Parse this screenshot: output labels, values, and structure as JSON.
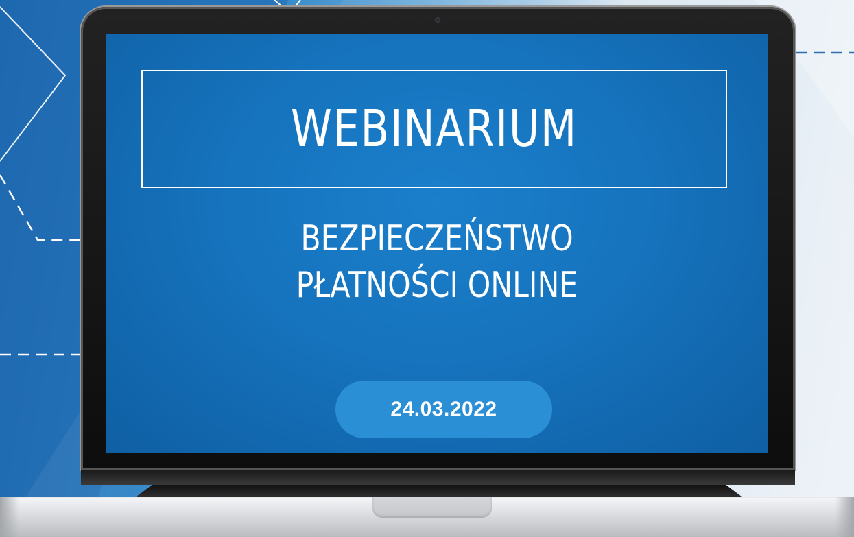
{
  "screen": {
    "title": "WEBINARIUM",
    "subtitle_line1": "BEZPIECZEŃSTWO",
    "subtitle_line2": "PŁATNOŚCI ONLINE",
    "date": "24.03.2022"
  },
  "colors": {
    "screen_blue": "#1673bd",
    "date_pill": "#2b8fd6",
    "text": "#ffffff"
  },
  "icons": {
    "camera": "laptop-camera-icon"
  }
}
